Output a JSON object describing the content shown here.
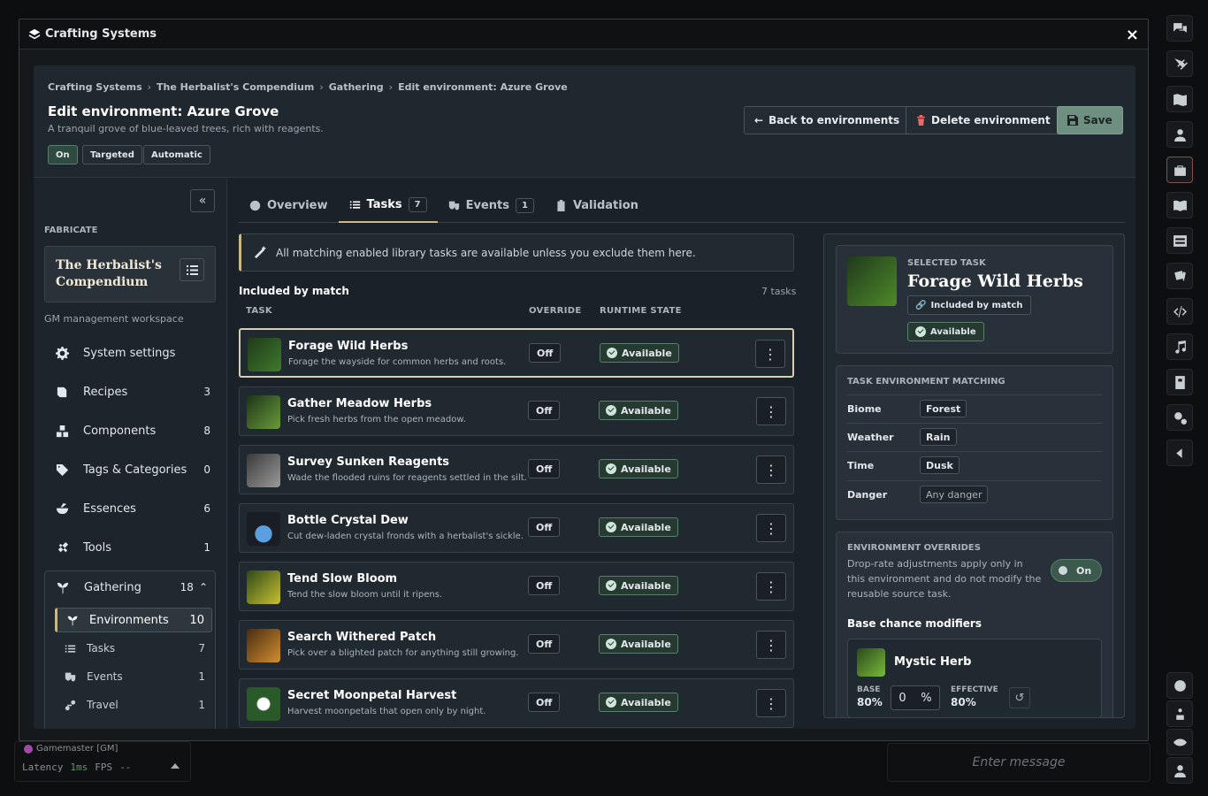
{
  "window": {
    "title": "Crafting Systems",
    "close": "×"
  },
  "breadcrumbs": [
    "Crafting Systems",
    "The Herbalist's Compendium",
    "Gathering",
    "Edit environment: Azure Grove"
  ],
  "header": {
    "title": "Edit environment: Azure Grove",
    "subtitle": "A tranquil grove of blue-leaved trees, rich with reagents.",
    "chips": [
      "On",
      "Targeted",
      "Automatic"
    ],
    "back": "Back to environments",
    "delete": "Delete environment",
    "save": "Save"
  },
  "sidebar": {
    "section": "FABRICATE",
    "book": "The Herbalist's Compendium",
    "workspace": "GM management workspace",
    "items": [
      {
        "label": "System settings",
        "count": ""
      },
      {
        "label": "Recipes",
        "count": "3"
      },
      {
        "label": "Components",
        "count": "8"
      },
      {
        "label": "Tags & Categories",
        "count": "0"
      },
      {
        "label": "Essences",
        "count": "6"
      },
      {
        "label": "Tools",
        "count": "1"
      }
    ],
    "gathering": {
      "label": "Gathering",
      "count": "18"
    },
    "sub": [
      {
        "label": "Environments",
        "count": "10"
      },
      {
        "label": "Tasks",
        "count": "7"
      },
      {
        "label": "Events",
        "count": "1"
      },
      {
        "label": "Travel",
        "count": "1"
      }
    ]
  },
  "tabs": [
    {
      "label": "Overview",
      "count": ""
    },
    {
      "label": "Tasks",
      "count": "7"
    },
    {
      "label": "Events",
      "count": "1"
    },
    {
      "label": "Validation",
      "count": ""
    }
  ],
  "notice": "All matching enabled library tasks are available unless you exclude them here.",
  "list": {
    "heading": "Included by match",
    "count": "7 tasks",
    "cols": [
      "TASK",
      "OVERRIDE",
      "RUNTIME STATE"
    ],
    "rows": [
      {
        "name": "Forage Wild Herbs",
        "desc": "Forage the wayside for common herbs and roots.",
        "override": "Off",
        "state": "Available"
      },
      {
        "name": "Gather Meadow Herbs",
        "desc": "Pick fresh herbs from the open meadow.",
        "override": "Off",
        "state": "Available"
      },
      {
        "name": "Survey Sunken Reagents",
        "desc": "Wade the flooded ruins for reagents settled in the silt.",
        "override": "Off",
        "state": "Available"
      },
      {
        "name": "Bottle Crystal Dew",
        "desc": "Cut dew-laden crystal fronds with a herbalist's sickle.",
        "override": "Off",
        "state": "Available"
      },
      {
        "name": "Tend Slow Bloom",
        "desc": "Tend the slow bloom until it ripens.",
        "override": "Off",
        "state": "Available"
      },
      {
        "name": "Search Withered Patch",
        "desc": "Pick over a blighted patch for anything still growing.",
        "override": "Off",
        "state": "Available"
      },
      {
        "name": "Secret Moonpetal Harvest",
        "desc": "Harvest moonpetals that open only by night.",
        "override": "Off",
        "state": "Available"
      }
    ]
  },
  "selected": {
    "label": "SELECTED TASK",
    "name": "Forage Wild Herbs",
    "badge1": "Included by match",
    "badge2": "Available"
  },
  "matching": {
    "title": "TASK ENVIRONMENT MATCHING",
    "rows": [
      {
        "k": "Biome",
        "v": "Forest"
      },
      {
        "k": "Weather",
        "v": "Rain"
      },
      {
        "k": "Time",
        "v": "Dusk"
      },
      {
        "k": "Danger",
        "v": "Any danger"
      }
    ]
  },
  "overrides": {
    "title": "ENVIRONMENT OVERRIDES",
    "desc": "Drop-rate adjustments apply only in this environment and do not modify the reusable source task.",
    "toggle": "On",
    "base_title": "Base chance modifiers",
    "item": {
      "name": "Mystic Herb",
      "base_label": "BASE",
      "base": "80%",
      "input": "0",
      "pct": "%",
      "eff_label": "EFFECTIVE",
      "eff": "80%"
    }
  },
  "footer": {
    "user": "Gamemaster [GM]",
    "latency_label": "Latency",
    "latency": "1ms",
    "fps_label": "FPS",
    "fps": "--"
  },
  "chat": {
    "placeholder": "Enter message"
  }
}
